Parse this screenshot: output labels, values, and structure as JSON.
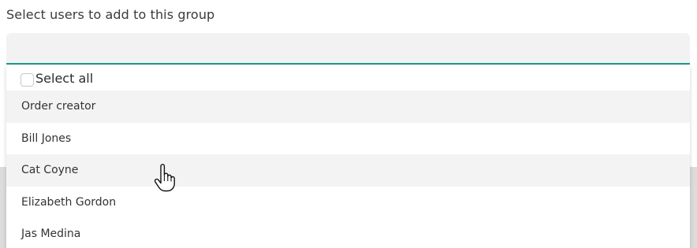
{
  "field": {
    "label": "Select users to add to this group",
    "value": ""
  },
  "dropdown": {
    "select_all_label": "Select all",
    "select_all_checked": false,
    "options": [
      {
        "label": "Order creator",
        "highlighted": true
      },
      {
        "label": "Bill Jones",
        "highlighted": false
      },
      {
        "label": "Cat Coyne",
        "highlighted": true
      },
      {
        "label": "Elizabeth Gordon",
        "highlighted": false
      },
      {
        "label": "Jas Medina",
        "highlighted": false
      }
    ]
  },
  "colors": {
    "accent": "#1a9a8a",
    "input_bg": "#f2f2f2",
    "row_shade": "#f3f3f3"
  },
  "cursor": {
    "icon": "hand-pointer-icon"
  }
}
